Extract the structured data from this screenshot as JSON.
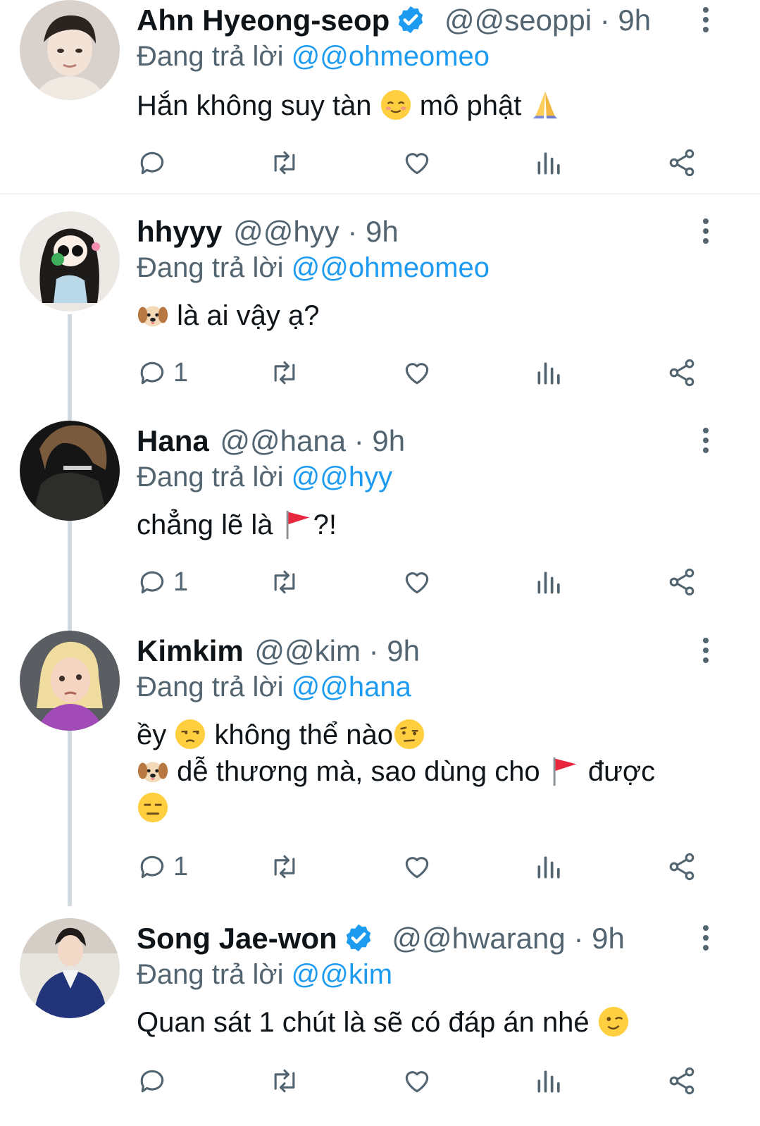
{
  "tweets": [
    {
      "name": "Ahn Hyeong-seop",
      "verified": true,
      "handle": "@@seoppi",
      "time": "· 9h",
      "reply_prefix": "Đang trả lời",
      "reply_to": "@@ohmeomeo",
      "lines": [
        [
          "Hắn không suy tàn ",
          "relieved-face-emoji",
          " mô phật ",
          "folded-hands-emoji"
        ]
      ],
      "reply_count": ""
    },
    {
      "name": "hhyyy",
      "verified": false,
      "handle": "@@hyy",
      "time": "· 9h",
      "reply_prefix": "Đang trả lời",
      "reply_to": "@@ohmeomeo",
      "lines": [
        [
          "dog-face-emoji",
          " là ai vậy ạ?"
        ]
      ],
      "reply_count": "1"
    },
    {
      "name": "Hana",
      "verified": false,
      "handle": "@@hana",
      "time": "· 9h",
      "reply_prefix": "Đang trả lời",
      "reply_to": "@@hyy",
      "lines": [
        [
          "chẳng lẽ là ",
          "red-flag-emoji",
          "?!"
        ]
      ],
      "reply_count": "1"
    },
    {
      "name": "Kimkim",
      "verified": false,
      "handle": "@@kim",
      "time": "· 9h",
      "reply_prefix": "Đang trả lời",
      "reply_to": "@@hana",
      "lines": [
        [
          "ềy ",
          "unamused-face-emoji",
          " không thể nào",
          "raised-eyebrow-emoji"
        ],
        [
          "dog-face-emoji",
          " dễ thương mà, sao dùng cho ",
          "red-flag-emoji",
          " được"
        ],
        [
          "expressionless-face-emoji"
        ]
      ],
      "reply_count": "1"
    },
    {
      "name": "Song Jae-won",
      "verified": true,
      "handle": "@@hwarang",
      "time": "· 9h",
      "reply_prefix": "Đang trả lời",
      "reply_to": "@@kim",
      "lines": [
        [
          "Quan sát 1 chút là sẽ có đáp án nhé ",
          "winking-face-emoji"
        ]
      ],
      "reply_count": ""
    }
  ],
  "icons": {
    "reply": "reply-icon",
    "retweet": "retweet-icon",
    "like": "heart-icon",
    "views": "views-icon",
    "share": "share-icon",
    "more": "more-vertical-icon"
  },
  "colors": {
    "text": "#0f1419",
    "secondary": "#536471",
    "link": "#1d9bf0",
    "verified": "#1d9bf0",
    "divider": "#eff3f4",
    "thread_line": "#cfd9de"
  }
}
